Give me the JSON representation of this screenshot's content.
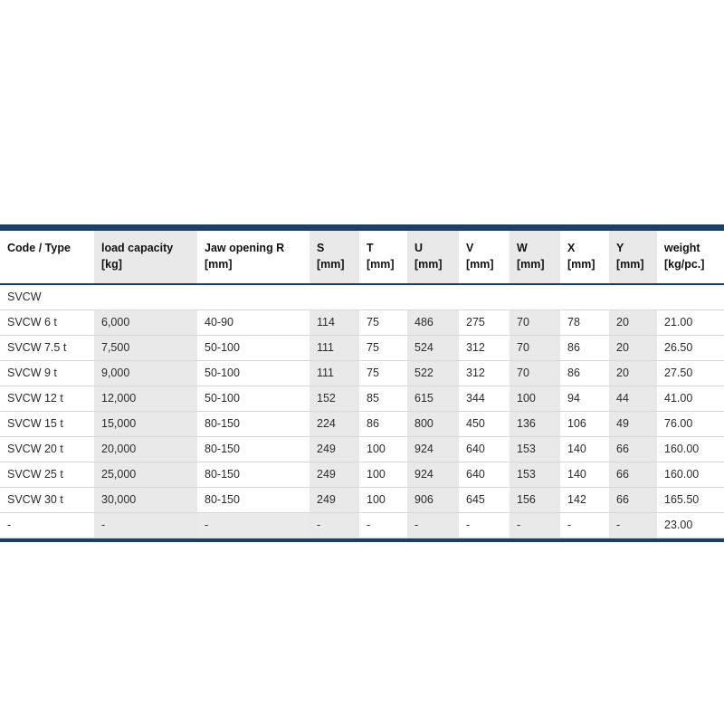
{
  "table": {
    "columns": [
      {
        "label": "Code / Type",
        "unit": "",
        "shaded": false
      },
      {
        "label": "load capacity",
        "unit": "[kg]",
        "shaded": true
      },
      {
        "label": "Jaw opening R",
        "unit": "[mm]",
        "shaded": false
      },
      {
        "label": "S",
        "unit": "[mm]",
        "shaded": true
      },
      {
        "label": "T",
        "unit": "[mm]",
        "shaded": false
      },
      {
        "label": "U",
        "unit": "[mm]",
        "shaded": true
      },
      {
        "label": "V",
        "unit": "[mm]",
        "shaded": false
      },
      {
        "label": "W",
        "unit": "[mm]",
        "shaded": true
      },
      {
        "label": "X",
        "unit": "[mm]",
        "shaded": false
      },
      {
        "label": "Y",
        "unit": "[mm]",
        "shaded": true
      },
      {
        "label": "weight",
        "unit": "[kg/pc.]",
        "shaded": false
      }
    ],
    "group_label": "SVCW",
    "rows": [
      [
        "SVCW 6 t",
        "6,000",
        "40-90",
        "114",
        "75",
        "486",
        "275",
        "70",
        "78",
        "20",
        "21.00"
      ],
      [
        "SVCW 7.5 t",
        "7,500",
        "50-100",
        "111",
        "75",
        "524",
        "312",
        "70",
        "86",
        "20",
        "26.50"
      ],
      [
        "SVCW 9 t",
        "9,000",
        "50-100",
        "111",
        "75",
        "522",
        "312",
        "70",
        "86",
        "20",
        "27.50"
      ],
      [
        "SVCW 12 t",
        "12,000",
        "50-100",
        "152",
        "85",
        "615",
        "344",
        "100",
        "94",
        "44",
        "41.00"
      ],
      [
        "SVCW 15 t",
        "15,000",
        "80-150",
        "224",
        "86",
        "800",
        "450",
        "136",
        "106",
        "49",
        "76.00"
      ],
      [
        "SVCW 20 t",
        "20,000",
        "80-150",
        "249",
        "100",
        "924",
        "640",
        "153",
        "140",
        "66",
        "160.00"
      ],
      [
        "SVCW 25 t",
        "25,000",
        "80-150",
        "249",
        "100",
        "924",
        "640",
        "153",
        "140",
        "66",
        "160.00"
      ],
      [
        "SVCW 30 t",
        "30,000",
        "80-150",
        "249",
        "100",
        "906",
        "645",
        "156",
        "142",
        "66",
        "165.50"
      ],
      [
        "-",
        "-",
        "-",
        "-",
        "-",
        "-",
        "-",
        "-",
        "-",
        "-",
        "23.00"
      ]
    ],
    "colors": {
      "rule": "#1d3f63",
      "shaded_cell": "#e9e9e9",
      "row_divider": "#d7d7d7",
      "text": "#2b2b2b",
      "header_text": "#111111"
    }
  }
}
